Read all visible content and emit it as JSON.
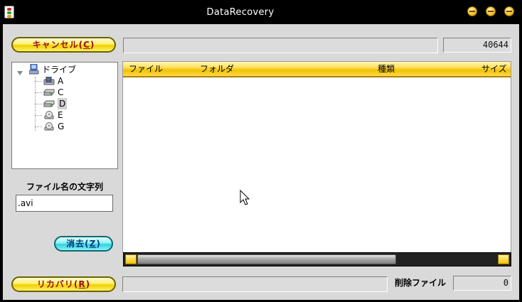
{
  "window": {
    "title": "DataRecovery"
  },
  "toolbar": {
    "cancel_label": "キャンセル(",
    "cancel_key": "C",
    "cancel_tail": ")",
    "count_value": "40644"
  },
  "tree": {
    "root_label": "ドライブ",
    "drives": [
      {
        "label": "A",
        "kind": "floppy"
      },
      {
        "label": "C",
        "kind": "hdd"
      },
      {
        "label": "D",
        "kind": "hdd",
        "selected": true
      },
      {
        "label": "E",
        "kind": "cdrom"
      },
      {
        "label": "G",
        "kind": "cdrom"
      }
    ]
  },
  "filter": {
    "caption": "ファイル名の文字列",
    "value": ".avi",
    "clear_label": "消去(",
    "clear_key": "Z",
    "clear_tail": ")"
  },
  "list": {
    "columns": [
      "ファイル",
      "フォルダ",
      "種類",
      "サイズ"
    ],
    "rows": []
  },
  "scrollbar": {
    "thumb_fraction": 0.72
  },
  "footer": {
    "recover_label": "リカバリ(",
    "recover_key": "R",
    "recover_tail": ")",
    "deleted_label": "削除ファイル",
    "deleted_value": "0"
  },
  "colors": {
    "title_text": "#ffffff",
    "header_gold": "#f2c200",
    "button_yellow": "#fff170",
    "button_cyan": "#2fd3e0"
  }
}
